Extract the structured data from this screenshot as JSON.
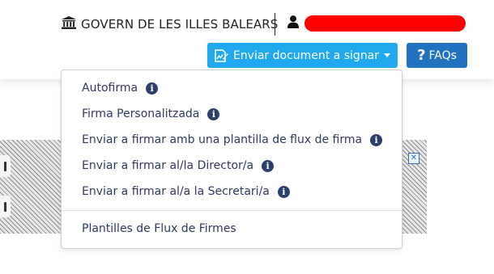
{
  "header": {
    "org_name": "GOVERN DE LES ILLES BALEARS",
    "user_name_redacted": true,
    "send_button_label": "Enviar document a signar",
    "faq_button_label": "FAQs",
    "colors": {
      "send_button": "#21a9f0",
      "faq_button": "#2173bf",
      "redaction": "#ff0000"
    },
    "icons": [
      "building-icon",
      "user-icon",
      "document-sign-icon",
      "question-icon"
    ]
  },
  "dropdown": {
    "items": [
      {
        "label": "Autofirma",
        "has_info": true
      },
      {
        "label": "Firma Personalitzada",
        "has_info": true
      },
      {
        "label": "Enviar a firmar amb una plantilla de flux de firma",
        "has_info": true
      },
      {
        "label": "Enviar a firmar al/la Director/a",
        "has_info": true
      },
      {
        "label": "Enviar a firmar al/a la Secretari/a",
        "has_info": true
      }
    ],
    "footer_item": {
      "label": "Plantilles de Flux de Firmes"
    },
    "info_glyph": "i"
  }
}
